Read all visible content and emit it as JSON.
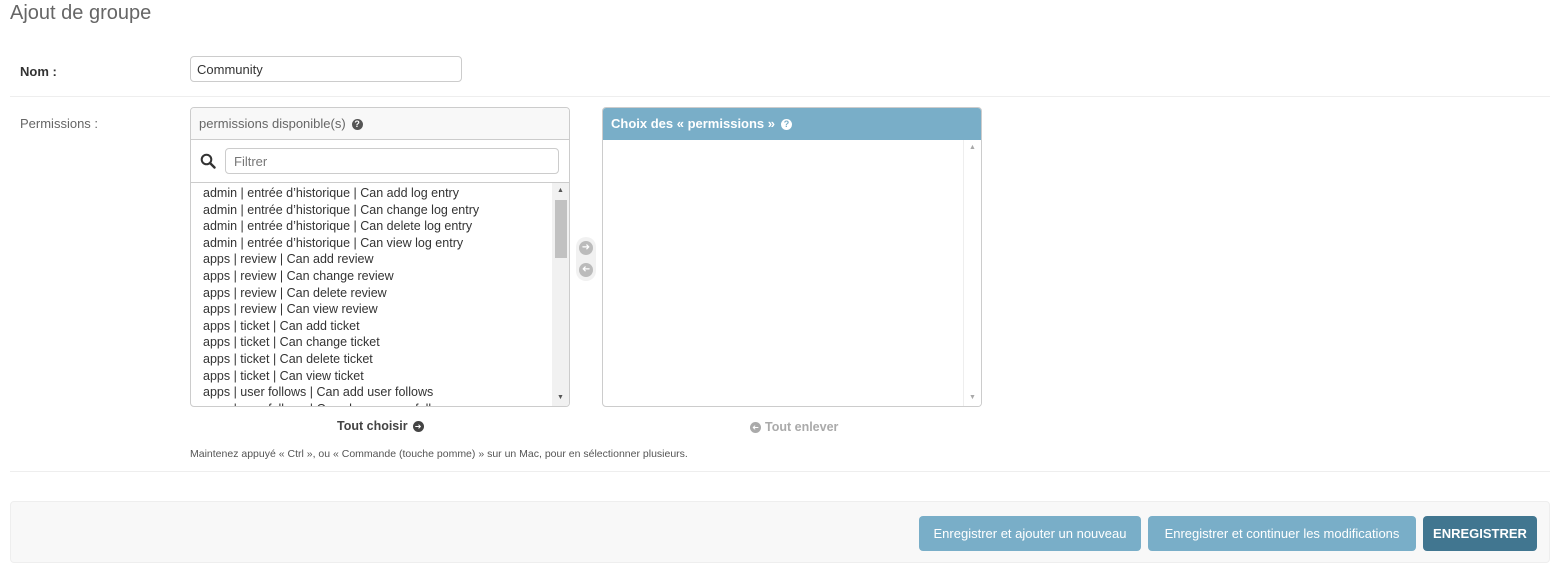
{
  "page": {
    "title": "Ajout de groupe"
  },
  "form": {
    "name_label": "Nom :",
    "name_value": "Community",
    "permissions_label": "Permissions :"
  },
  "available": {
    "title": "permissions disponible(s)",
    "filter_placeholder": "Filtrer",
    "items": [
      "admin | entrée d’historique | Can add log entry",
      "admin | entrée d’historique | Can change log entry",
      "admin | entrée d’historique | Can delete log entry",
      "admin | entrée d’historique | Can view log entry",
      "apps | review | Can add review",
      "apps | review | Can change review",
      "apps | review | Can delete review",
      "apps | review | Can view review",
      "apps | ticket | Can add ticket",
      "apps | ticket | Can change ticket",
      "apps | ticket | Can delete ticket",
      "apps | ticket | Can view ticket",
      "apps | user follows | Can add user follows",
      "apps | user follows | Can change user follows"
    ],
    "choose_all_label": "Tout choisir"
  },
  "chosen": {
    "title": "Choix des « permissions »",
    "remove_all_label": "Tout enlever"
  },
  "help_text": "Maintenez appuyé « Ctrl », ou « Commande (touche pomme) » sur un Mac, pour en sélectionner plusieurs.",
  "actions": {
    "save_add_new": "Enregistrer et ajouter un nouveau",
    "save_continue": "Enregistrer et continuer les modifications",
    "save": "ENREGISTRER"
  },
  "colors": {
    "accent": "#79aec8",
    "primary_button": "#417690"
  }
}
